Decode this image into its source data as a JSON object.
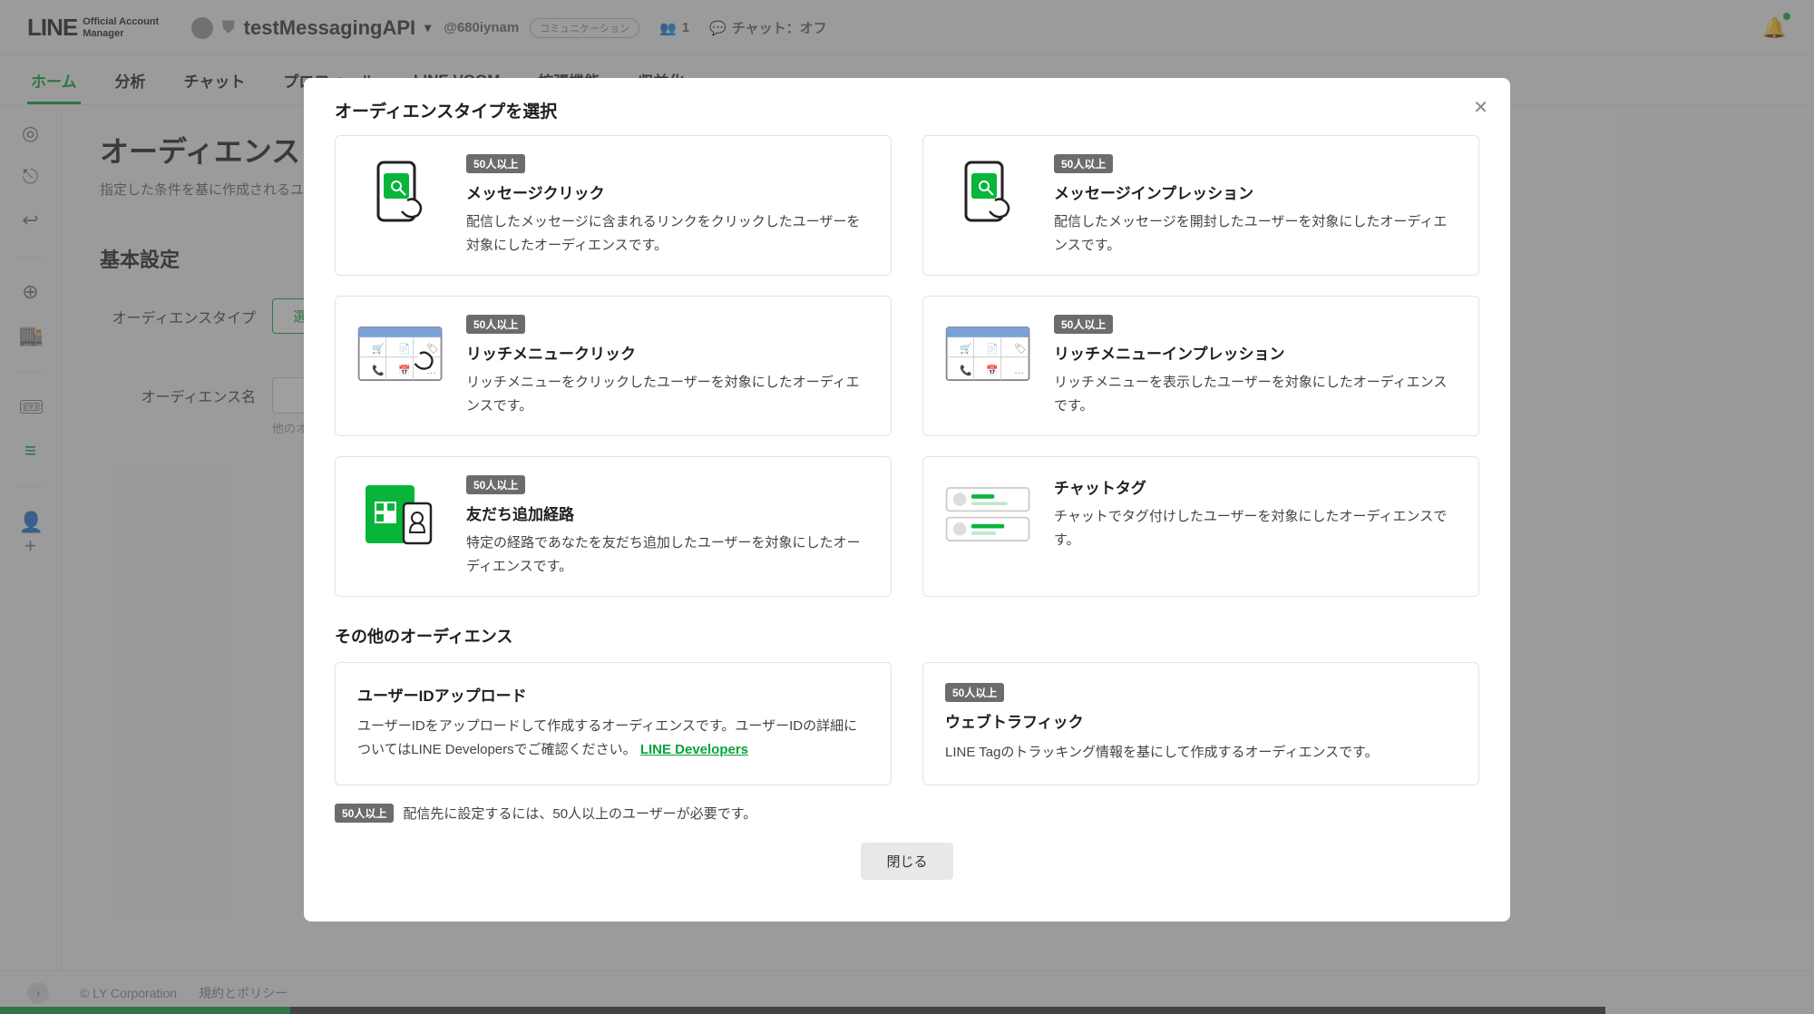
{
  "header": {
    "logo_main": "LINE",
    "logo_sub1": "Official Account",
    "logo_sub2": "Manager",
    "account_name": "testMessagingAPI",
    "handle": "@680iynam",
    "comm_chip": "コミュニケーション",
    "followers": "1",
    "chat_status": "チャット：オフ"
  },
  "tabs": [
    "ホーム",
    "分析",
    "チャット",
    "プロフィール",
    "LINE VOOM",
    "拡張機能",
    "収益化"
  ],
  "sidebar_icons": [
    "broadcast-icon",
    "share-icon",
    "reply-icon",
    "sep",
    "add-message-icon",
    "shop-icon",
    "sep",
    "coupon-icon",
    "database-icon",
    "sep",
    "add-user-icon"
  ],
  "page": {
    "title": "オーディエンス",
    "desc": "指定した条件を基に作成されるユーザーの",
    "section": "基本設定",
    "row1_label": "オーディエンスタイプ",
    "select_btn": "選択",
    "row2_label": "オーディエンス名",
    "hint": "他のオーディ"
  },
  "footer": {
    "copyright": "© LY Corporation",
    "policy": "規約とポリシー"
  },
  "modal": {
    "title": "オーディエンスタイプを選択",
    "badge": "50人以上",
    "cards": [
      {
        "title": "メッセージクリック",
        "desc": "配信したメッセージに含まれるリンクをクリックしたユーザーを対象にしたオーディエンスです。",
        "badge": true,
        "icon": "phone-tap"
      },
      {
        "title": "メッセージインプレッション",
        "desc": "配信したメッセージを開封したユーザーを対象にしたオーディエンスです。",
        "badge": true,
        "icon": "phone-tap"
      },
      {
        "title": "リッチメニュークリック",
        "desc": "リッチメニューをクリックしたユーザーを対象にしたオーディエンスです。",
        "badge": true,
        "icon": "richmenu-tap"
      },
      {
        "title": "リッチメニューインプレッション",
        "desc": "リッチメニューを表示したユーザーを対象にしたオーディエンスです。",
        "badge": true,
        "icon": "richmenu"
      },
      {
        "title": "友だち追加経路",
        "desc": "特定の経路であなたを友だち追加したユーザーを対象にしたオーディエンスです。",
        "badge": true,
        "icon": "qr"
      },
      {
        "title": "チャットタグ",
        "desc": "チャットでタグ付けしたユーザーを対象にしたオーディエンスです。",
        "badge": false,
        "icon": "tags"
      }
    ],
    "section2": "その他のオーディエンス",
    "simplecards": [
      {
        "title": "ユーザーIDアップロード",
        "desc_a": "ユーザーIDをアップロードして作成するオーディエンスです。ユーザーIDの詳細についてはLINE Developersでご確認ください。",
        "link": "LINE Developers",
        "badge": false
      },
      {
        "title": "ウェブトラフィック",
        "desc_a": "LINE Tagのトラッキング情報を基にして作成するオーディエンスです。",
        "badge": true
      }
    ],
    "note": "配信先に設定するには、50人以上のユーザーが必要です。",
    "close": "閉じる"
  }
}
